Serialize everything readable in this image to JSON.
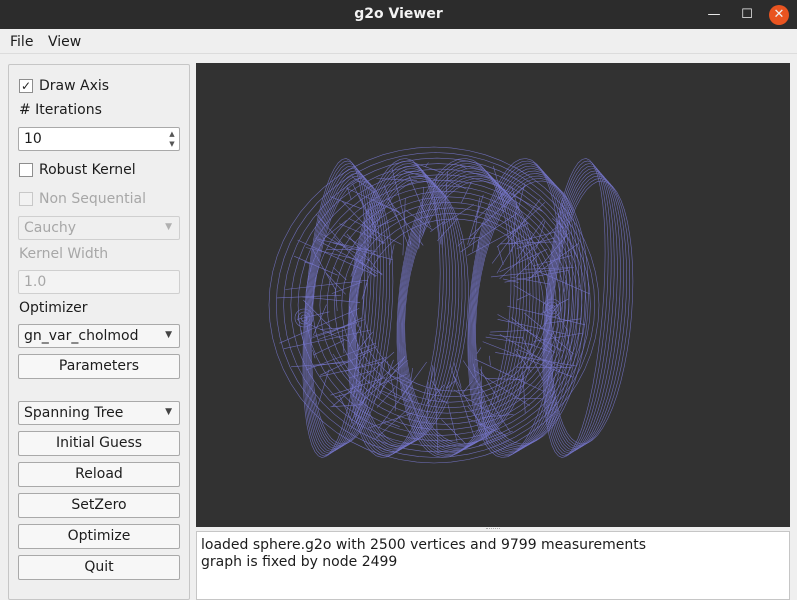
{
  "window": {
    "title": "g2o Viewer",
    "minimize_glyph": "—",
    "maximize_glyph": "☐",
    "close_glyph": "✕"
  },
  "menu": {
    "items": [
      "File",
      "View"
    ]
  },
  "sidebar": {
    "draw_axis": {
      "label": "Draw Axis",
      "checked": true,
      "mark": "✓"
    },
    "iterations_label": "# Iterations",
    "iterations_value": "10",
    "spin_up": "▲",
    "spin_down": "▼",
    "robust_kernel": {
      "label": "Robust Kernel",
      "checked": false
    },
    "non_sequential": {
      "label": "Non Sequential",
      "checked": false,
      "enabled": false
    },
    "robust_kernel_select": {
      "value": "Cauchy",
      "enabled": false
    },
    "kernel_width_label": "Kernel Width",
    "kernel_width_value": "1.0",
    "optimizer_label": "Optimizer",
    "optimizer_select": {
      "value": "gn_var_cholmod"
    },
    "parameters_button": "Parameters",
    "initial_guess_select": {
      "value": "Spanning Tree"
    },
    "initial_guess_button": "Initial Guess",
    "reload_button": "Reload",
    "setzero_button": "SetZero",
    "optimize_button": "Optimize",
    "quit_button": "Quit",
    "combo_arrow": "▼"
  },
  "viewport": {
    "background": "#323232",
    "mesh_color": "#7777cc",
    "content": "3D wireframe pose graph of sphere.g2o"
  },
  "log": {
    "lines": [
      "loaded sphere.g2o with 2500 vertices and 9799 measurements",
      "graph is fixed by node 2499"
    ]
  }
}
